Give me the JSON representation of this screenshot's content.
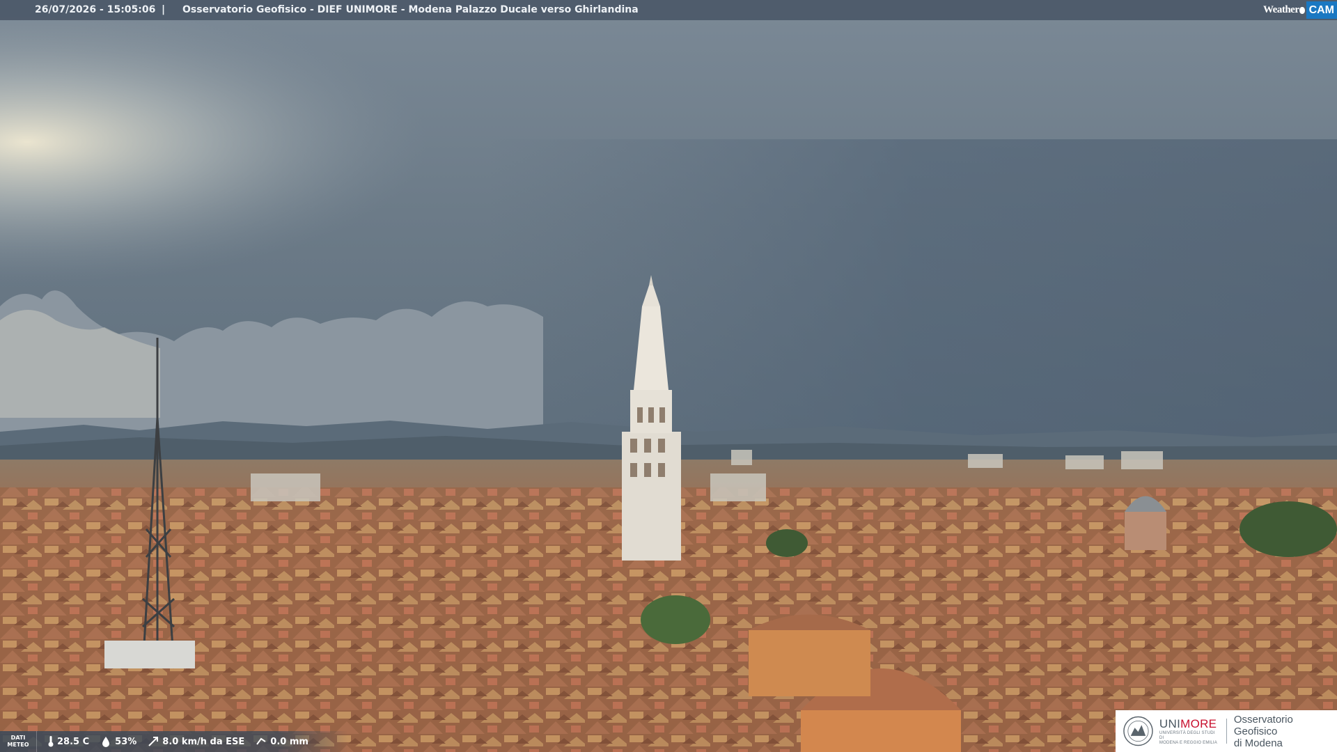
{
  "header": {
    "timestamp": "26/07/2026 - 15:05:06",
    "separator": "|",
    "title": "Osservatorio Geofisico - DIEF UNIMORE - Modena Palazzo Ducale verso Ghirlandina",
    "brand_weather": "Weather",
    "brand_cam": "CAM"
  },
  "weather": {
    "label_line1": "DATI",
    "label_line2": "METEO",
    "temperature": "28.5 C",
    "humidity": "53%",
    "wind": "8.0 km/h da ESE",
    "rain": "0.0 mm",
    "icons": [
      "thermometer-icon",
      "humidity-drop-icon",
      "wind-icon",
      "rain-icon"
    ]
  },
  "logo": {
    "uni_prefix": "UNI",
    "uni_suffix": "MORE",
    "university_line1": "UNIVERSITÀ DEGLI STUDI DI",
    "university_line2": "MODENA E REGGIO EMILIA",
    "observatory_line1": "Osservatorio Geofisico",
    "observatory_line2": "di Modena"
  },
  "colors": {
    "sky_top": "#7c8a96",
    "storm": "#56677a",
    "roofs": "#9b6a4f",
    "tower": "#e3ded4",
    "brand_blue": "#1a78c2",
    "unimore_red": "#c8102e"
  }
}
